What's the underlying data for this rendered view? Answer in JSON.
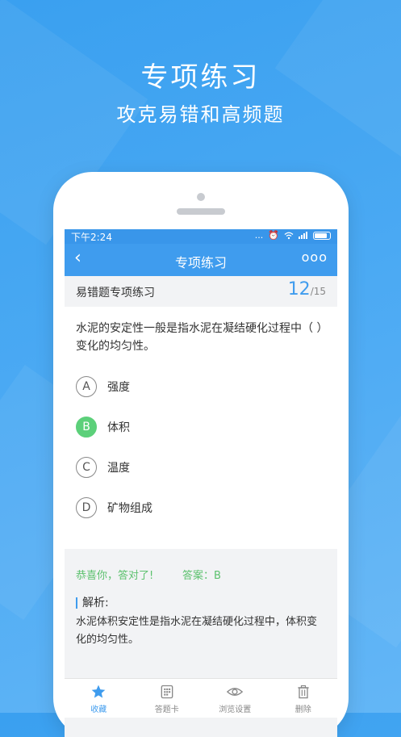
{
  "promo": {
    "title": "专项练习",
    "subtitle": "攻克易错和高频题"
  },
  "statusbar": {
    "time": "下午2:24",
    "dots": "...",
    "alarm": "⏰"
  },
  "navbar": {
    "back": "‹",
    "title": "专项练习",
    "more": "ooo"
  },
  "subheader": {
    "label": "易错题专项练习",
    "current": "12",
    "total": "/15"
  },
  "question": {
    "text": "水泥的安定性一般是指水泥在凝结硬化过程中（  ）变化的均匀性。",
    "options": [
      {
        "letter": "A",
        "text": "强度"
      },
      {
        "letter": "B",
        "text": "体积"
      },
      {
        "letter": "C",
        "text": "温度"
      },
      {
        "letter": "D",
        "text": "矿物组成"
      }
    ],
    "correct_color": "#5cd07a"
  },
  "result": {
    "congrats": "恭喜你，答对了!",
    "answer": "答案：B",
    "analysis_title": "解析:",
    "analysis_text": "水泥体积安定性是指水泥在凝结硬化过程中，体积变化的均匀性。"
  },
  "tabbar": {
    "items": [
      {
        "label": "收藏",
        "icon": "star-icon"
      },
      {
        "label": "答题卡",
        "icon": "card-icon"
      },
      {
        "label": "浏览设置",
        "icon": "eye-icon"
      },
      {
        "label": "删除",
        "icon": "trash-icon"
      }
    ]
  },
  "colors": {
    "accent": "#3f9cee",
    "success": "#5cc16e"
  }
}
